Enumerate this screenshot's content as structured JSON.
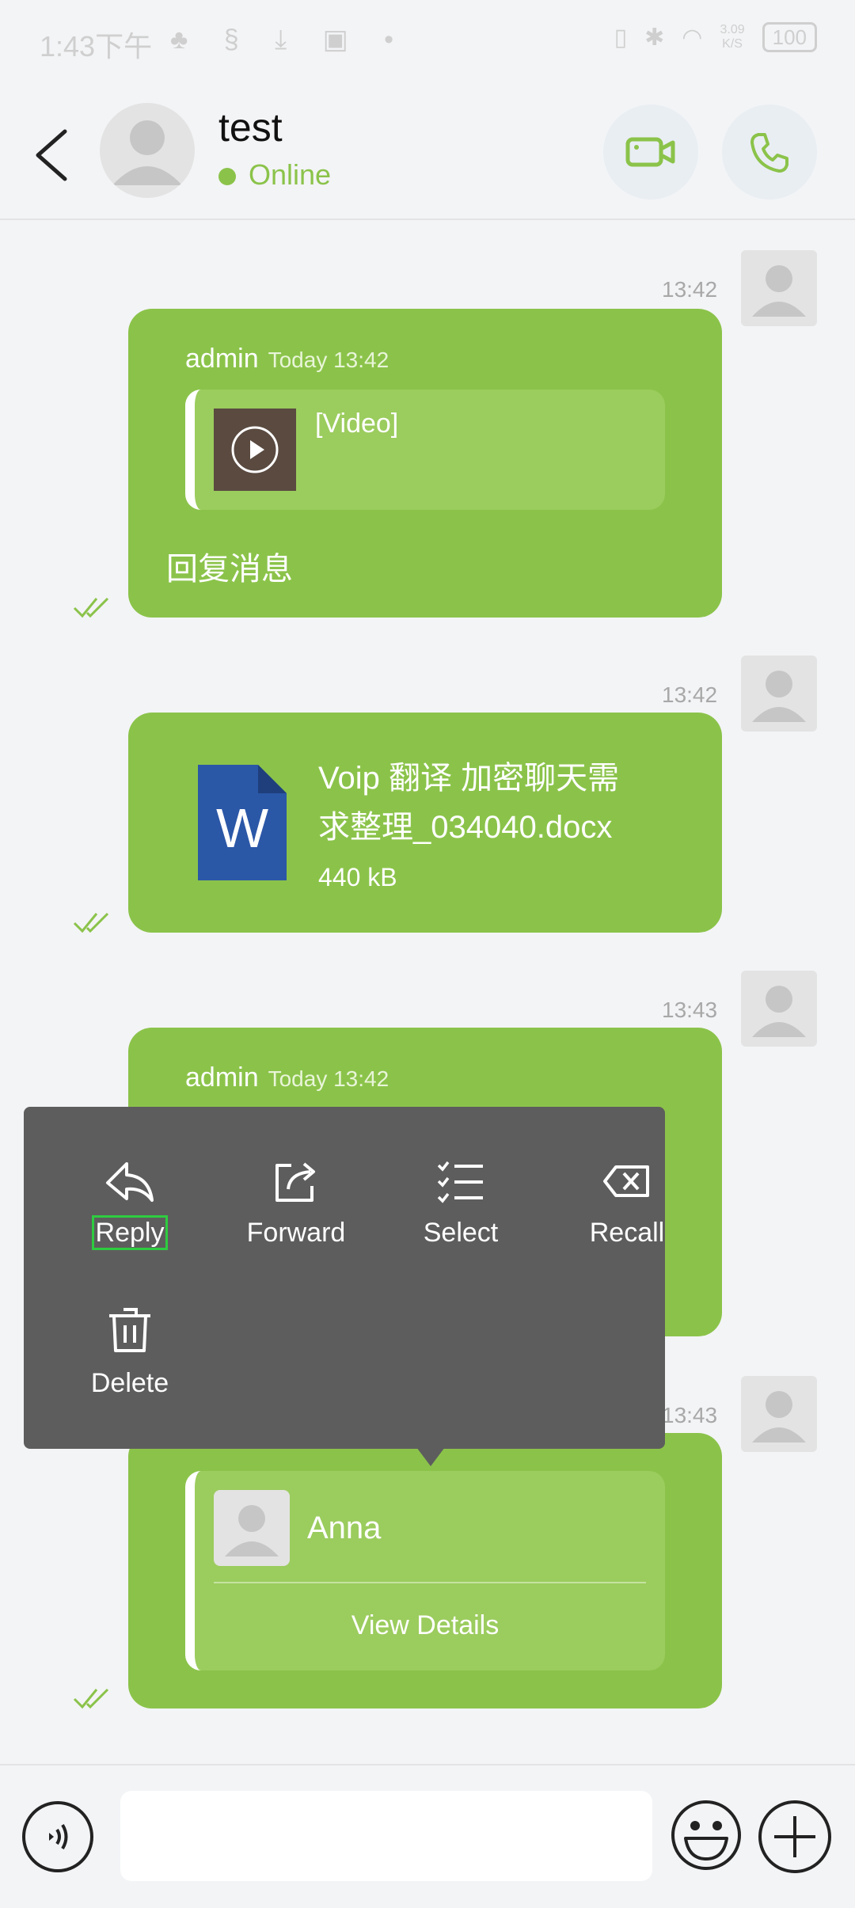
{
  "status_bar": {
    "time": "1:43下午",
    "net_speed_value": "3.09",
    "net_speed_unit": "K/S",
    "battery": "100"
  },
  "header": {
    "contact_name": "test",
    "presence": "Online"
  },
  "messages": [
    {
      "time": "13:42",
      "sender": "admin",
      "sender_time": "Today 13:42",
      "quote_label": "[Video]",
      "text": "回复消息"
    },
    {
      "time": "13:42",
      "file_name_line1": "Voip 翻译 加密聊天需",
      "file_name_line2": "求整理_034040.docx",
      "file_size": "440 kB",
      "file_icon_letter": "W"
    },
    {
      "time": "13:43",
      "sender": "admin",
      "sender_time": "Today 13:42"
    },
    {
      "time": "13:43",
      "card_name": "Anna",
      "card_action": "View Details"
    }
  ],
  "context_menu": {
    "items": [
      {
        "label": "Reply",
        "icon": "reply-icon"
      },
      {
        "label": "Forward",
        "icon": "forward-icon"
      },
      {
        "label": "Select",
        "icon": "select-icon"
      },
      {
        "label": "Recall",
        "icon": "recall-icon"
      },
      {
        "label": "Delete",
        "icon": "delete-icon"
      }
    ]
  },
  "input": {
    "placeholder": ""
  },
  "colors": {
    "accent": "#8bc34a",
    "menu_bg": "#5d5d5d",
    "background": "#f3f4f6"
  }
}
